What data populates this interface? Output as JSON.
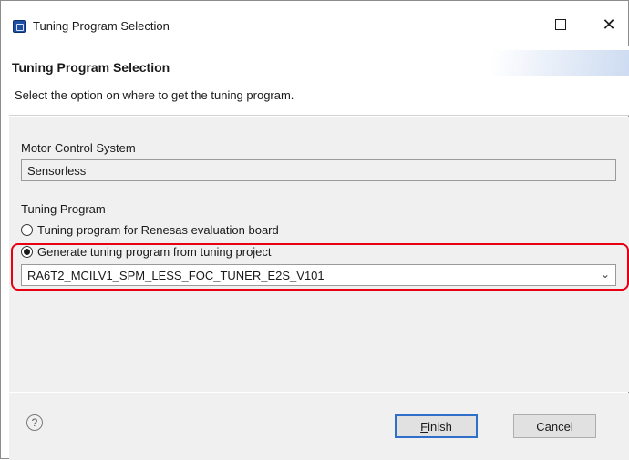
{
  "window": {
    "title": "Tuning Program Selection",
    "icon": "app-icon",
    "controls": {
      "minimize_icon": "minimize-icon",
      "maximize_icon": "maximize-icon",
      "close_glyph": "✕"
    }
  },
  "banner": {
    "title": "Tuning Program Selection",
    "description": "Select the option on where to get the tuning program."
  },
  "motor_control": {
    "label": "Motor Control System",
    "value": "Sensorless"
  },
  "tuning_program": {
    "label": "Tuning Program",
    "options": [
      {
        "label": "Tuning program for Renesas evaluation board",
        "selected": false
      },
      {
        "label": "Generate tuning program from tuning project",
        "selected": true
      }
    ],
    "project_select": {
      "value": "RA6T2_MCILV1_SPM_LESS_FOC_TUNER_E2S_V101",
      "arrow_glyph": "⌄"
    }
  },
  "footer": {
    "help_glyph": "?",
    "finish_mnemonic": "F",
    "finish_rest": "inish",
    "cancel_label": "Cancel"
  },
  "colors": {
    "highlight": "#e60012",
    "default_button_border": "#2f6fc9",
    "panel_bg": "#f0f0f0"
  }
}
